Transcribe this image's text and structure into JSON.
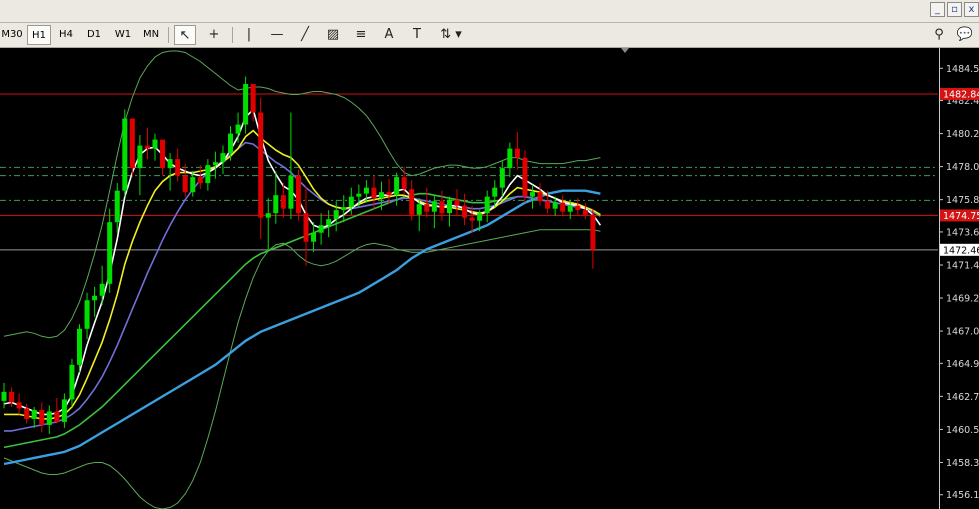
{
  "timeframes": [
    "M30",
    "H1",
    "H4",
    "D1",
    "W1",
    "MN"
  ],
  "selected_timeframe": "H1",
  "tools": [
    {
      "name": "cursor-tool-icon",
      "glyph": "↖"
    },
    {
      "name": "crosshair-tool-icon",
      "glyph": "+"
    },
    {
      "name": "vertical-line-tool-icon",
      "glyph": "|"
    },
    {
      "name": "horizontal-line-tool-icon",
      "glyph": "—"
    },
    {
      "name": "trendline-tool-icon",
      "glyph": "╱"
    },
    {
      "name": "equidistant-channel-tool-icon",
      "glyph": "▨"
    },
    {
      "name": "fibonacci-tool-icon",
      "glyph": "≡"
    },
    {
      "name": "text-tool-icon",
      "glyph": "A"
    },
    {
      "name": "text-label-tool-icon",
      "glyph": "T"
    },
    {
      "name": "arrows-tool-icon",
      "glyph": "⇅"
    }
  ],
  "window_buttons": [
    "minimize-icon",
    "restore-icon",
    "close-icon"
  ],
  "chart_data": {
    "type": "candlestick",
    "ylim": [
      1455.6,
      1485.5
    ],
    "price_ticks": [
      "1484.55",
      "1482.40",
      "1480.20",
      "1478.00",
      "1475.80",
      "1473.65",
      "1471.45",
      "1469.25",
      "1467.05",
      "1464.90",
      "1462.70",
      "1460.50",
      "1458.30",
      "1456.15"
    ],
    "tick_values": [
      1484.55,
      1482.4,
      1480.2,
      1478.0,
      1475.8,
      1473.65,
      1471.45,
      1469.25,
      1467.05,
      1464.9,
      1462.7,
      1460.5,
      1458.3,
      1456.15
    ],
    "current_price_label": "1472.46",
    "current_price": 1472.46,
    "red_line_labels": [
      {
        "text": "1482.84",
        "value": 1482.84
      },
      {
        "text": "1474.75",
        "value": 1474.75
      }
    ],
    "dashed_levels": [
      1477.95,
      1477.4,
      1475.75
    ],
    "candles": [
      [
        1462.4,
        1463.6,
        1461.9,
        1463.0
      ],
      [
        1463.0,
        1463.3,
        1462.0,
        1462.3
      ],
      [
        1462.3,
        1462.9,
        1461.5,
        1461.9
      ],
      [
        1461.9,
        1462.2,
        1460.9,
        1461.2
      ],
      [
        1461.2,
        1462.0,
        1460.6,
        1461.8
      ],
      [
        1461.8,
        1462.3,
        1460.3,
        1460.8
      ],
      [
        1460.8,
        1462.1,
        1460.2,
        1461.7
      ],
      [
        1461.7,
        1462.6,
        1460.9,
        1461.0
      ],
      [
        1461.0,
        1462.9,
        1460.6,
        1462.5
      ],
      [
        1462.5,
        1465.2,
        1462.0,
        1464.8
      ],
      [
        1464.8,
        1467.5,
        1464.3,
        1467.2
      ],
      [
        1467.2,
        1469.6,
        1466.5,
        1469.1
      ],
      [
        1469.1,
        1470.0,
        1468.0,
        1469.4
      ],
      [
        1469.4,
        1471.4,
        1468.8,
        1470.2
      ],
      [
        1470.2,
        1475.2,
        1469.6,
        1474.3
      ],
      [
        1474.3,
        1476.9,
        1473.6,
        1476.4
      ],
      [
        1476.4,
        1481.8,
        1476.0,
        1481.2
      ],
      [
        1481.2,
        1479.8,
        1477.3,
        1477.9
      ],
      [
        1477.9,
        1480.1,
        1476.1,
        1479.4
      ],
      [
        1479.4,
        1480.6,
        1478.5,
        1479.2
      ],
      [
        1479.2,
        1480.2,
        1478.4,
        1479.8
      ],
      [
        1479.8,
        1479.3,
        1477.4,
        1477.9
      ],
      [
        1477.9,
        1478.9,
        1476.4,
        1478.5
      ],
      [
        1478.5,
        1479.2,
        1477.0,
        1477.4
      ],
      [
        1477.4,
        1478.2,
        1476.0,
        1476.3
      ],
      [
        1476.3,
        1477.7,
        1476.0,
        1477.3
      ],
      [
        1477.3,
        1478.1,
        1476.5,
        1476.9
      ],
      [
        1476.9,
        1478.5,
        1476.4,
        1478.1
      ],
      [
        1478.1,
        1479.0,
        1477.2,
        1478.3
      ],
      [
        1478.3,
        1479.4,
        1477.5,
        1478.9
      ],
      [
        1478.9,
        1480.7,
        1478.4,
        1480.2
      ],
      [
        1480.2,
        1481.6,
        1479.6,
        1480.8
      ],
      [
        1480.8,
        1484.0,
        1480.2,
        1483.5
      ],
      [
        1483.5,
        1482.1,
        1481.0,
        1481.6
      ],
      [
        1481.6,
        1482.6,
        1473.2,
        1474.6
      ],
      [
        1474.6,
        1475.9,
        1472.4,
        1474.9
      ],
      [
        1474.9,
        1477.7,
        1474.2,
        1476.1
      ],
      [
        1476.1,
        1476.9,
        1474.6,
        1475.2
      ],
      [
        1475.2,
        1481.6,
        1474.5,
        1477.4
      ],
      [
        1477.4,
        1477.8,
        1474.4,
        1474.9
      ],
      [
        1474.9,
        1476.7,
        1471.4,
        1473.0
      ],
      [
        1473.0,
        1474.3,
        1472.3,
        1473.6
      ],
      [
        1473.6,
        1474.9,
        1472.8,
        1474.1
      ],
      [
        1474.1,
        1475.1,
        1473.3,
        1474.5
      ],
      [
        1474.5,
        1475.7,
        1473.7,
        1475.1
      ],
      [
        1475.1,
        1476.1,
        1474.3,
        1475.3
      ],
      [
        1475.3,
        1476.6,
        1474.8,
        1476.0
      ],
      [
        1476.0,
        1476.8,
        1475.3,
        1476.2
      ],
      [
        1476.2,
        1477.1,
        1475.6,
        1476.6
      ],
      [
        1476.6,
        1477.4,
        1475.2,
        1475.9
      ],
      [
        1475.9,
        1477.0,
        1475.1,
        1476.3
      ],
      [
        1476.3,
        1477.2,
        1475.5,
        1476.1
      ],
      [
        1476.1,
        1477.6,
        1475.4,
        1477.3
      ],
      [
        1477.3,
        1478.0,
        1476.1,
        1476.5
      ],
      [
        1476.5,
        1477.1,
        1474.4,
        1474.8
      ],
      [
        1474.8,
        1475.9,
        1473.7,
        1475.5
      ],
      [
        1475.5,
        1476.6,
        1474.6,
        1475.0
      ],
      [
        1475.0,
        1476.1,
        1473.9,
        1475.7
      ],
      [
        1475.7,
        1476.4,
        1474.4,
        1474.9
      ],
      [
        1474.9,
        1476.0,
        1474.0,
        1475.8
      ],
      [
        1475.8,
        1476.5,
        1474.8,
        1475.4
      ],
      [
        1475.4,
        1476.2,
        1474.1,
        1474.6
      ],
      [
        1474.6,
        1475.4,
        1473.6,
        1474.4
      ],
      [
        1474.4,
        1475.1,
        1473.7,
        1474.9
      ],
      [
        1474.9,
        1476.4,
        1474.3,
        1476.0
      ],
      [
        1476.0,
        1477.1,
        1475.3,
        1476.6
      ],
      [
        1476.6,
        1478.4,
        1476.0,
        1477.9
      ],
      [
        1477.9,
        1479.6,
        1477.3,
        1479.2
      ],
      [
        1479.2,
        1480.3,
        1477.8,
        1478.6
      ],
      [
        1478.6,
        1479.1,
        1475.6,
        1476.0
      ],
      [
        1476.0,
        1476.8,
        1475.2,
        1476.3
      ],
      [
        1476.3,
        1476.9,
        1475.4,
        1475.7
      ],
      [
        1475.7,
        1476.4,
        1474.9,
        1475.2
      ],
      [
        1475.2,
        1476.0,
        1474.7,
        1475.6
      ],
      [
        1475.6,
        1476.1,
        1474.8,
        1475.0
      ],
      [
        1475.0,
        1475.8,
        1474.5,
        1475.4
      ],
      [
        1475.4,
        1475.9,
        1474.8,
        1475.1
      ],
      [
        1475.1,
        1475.6,
        1474.5,
        1474.8
      ],
      [
        1474.8,
        1475.2,
        1471.2,
        1472.46
      ]
    ],
    "indicators": [
      {
        "name": "bollinger-upper",
        "color": "#5aa85a",
        "values": [
          1466.7,
          1466.8,
          1466.9,
          1467.0,
          1466.9,
          1466.7,
          1466.6,
          1466.7,
          1467.1,
          1467.9,
          1469.0,
          1470.5,
          1472.2,
          1474.1,
          1476.4,
          1478.8,
          1481.0,
          1482.6,
          1483.9,
          1484.7,
          1485.3,
          1485.6,
          1485.7,
          1485.7,
          1485.6,
          1485.3,
          1485.0,
          1484.6,
          1484.2,
          1483.8,
          1483.4,
          1483.1,
          1483.2,
          1483.3,
          1483.3,
          1483.2,
          1483.0,
          1482.9,
          1482.8,
          1482.8,
          1482.9,
          1483.0,
          1483.0,
          1482.9,
          1482.8,
          1482.6,
          1482.3,
          1481.9,
          1481.4,
          1480.7,
          1479.9,
          1479.0,
          1478.2,
          1477.6,
          1477.4,
          1477.5,
          1477.7,
          1477.9,
          1478.0,
          1478.1,
          1478.1,
          1478.0,
          1477.9,
          1477.9,
          1478.0,
          1478.2,
          1478.4,
          1478.6,
          1478.6,
          1478.4,
          1478.3,
          1478.2,
          1478.2,
          1478.2,
          1478.2,
          1478.3,
          1478.4,
          1478.4,
          1478.5,
          1478.6
        ]
      },
      {
        "name": "bollinger-lower",
        "color": "#5aa85a",
        "values": [
          1458.6,
          1458.4,
          1458.2,
          1458.0,
          1457.8,
          1457.6,
          1457.5,
          1457.5,
          1457.6,
          1457.8,
          1458.0,
          1458.2,
          1458.3,
          1458.3,
          1458.1,
          1457.7,
          1457.2,
          1456.6,
          1456.0,
          1455.6,
          1455.3,
          1455.2,
          1455.3,
          1455.6,
          1456.2,
          1457.1,
          1458.3,
          1459.9,
          1461.7,
          1463.7,
          1465.7,
          1467.6,
          1469.2,
          1470.6,
          1471.7,
          1472.4,
          1472.8,
          1472.9,
          1472.6,
          1472.1,
          1471.7,
          1471.5,
          1471.4,
          1471.5,
          1471.7,
          1472.0,
          1472.3,
          1472.6,
          1472.8,
          1472.9,
          1472.8,
          1472.7,
          1472.5,
          1472.4,
          1472.3,
          1472.3,
          1472.3,
          1472.4,
          1472.5,
          1472.6,
          1472.7,
          1472.8,
          1472.9,
          1473.0,
          1473.1,
          1473.2,
          1473.3,
          1473.4,
          1473.5,
          1473.6,
          1473.7,
          1473.8,
          1473.8,
          1473.8,
          1473.8,
          1473.8,
          1473.8,
          1473.8,
          1473.8,
          1473.7
        ]
      },
      {
        "name": "moving-average-slow-blue",
        "color": "#3aa0e0",
        "values": [
          1458.2,
          1458.3,
          1458.4,
          1458.5,
          1458.6,
          1458.7,
          1458.8,
          1458.9,
          1459.0,
          1459.2,
          1459.4,
          1459.7,
          1460.0,
          1460.3,
          1460.6,
          1460.9,
          1461.2,
          1461.5,
          1461.8,
          1462.1,
          1462.4,
          1462.7,
          1463.0,
          1463.3,
          1463.6,
          1463.9,
          1464.2,
          1464.5,
          1464.8,
          1465.2,
          1465.6,
          1466.0,
          1466.4,
          1466.7,
          1467.0,
          1467.2,
          1467.4,
          1467.6,
          1467.8,
          1468.0,
          1468.2,
          1468.4,
          1468.6,
          1468.8,
          1469.0,
          1469.2,
          1469.4,
          1469.6,
          1469.9,
          1470.2,
          1470.5,
          1470.8,
          1471.1,
          1471.5,
          1471.9,
          1472.2,
          1472.5,
          1472.7,
          1472.9,
          1473.1,
          1473.3,
          1473.5,
          1473.7,
          1473.9,
          1474.1,
          1474.4,
          1474.7,
          1475.0,
          1475.3,
          1475.6,
          1475.8,
          1476.0,
          1476.2,
          1476.3,
          1476.4,
          1476.4,
          1476.4,
          1476.4,
          1476.3,
          1476.2
        ]
      },
      {
        "name": "moving-average-green",
        "color": "#3cc23c",
        "values": [
          1459.3,
          1459.4,
          1459.5,
          1459.6,
          1459.7,
          1459.8,
          1459.9,
          1460.0,
          1460.2,
          1460.5,
          1460.8,
          1461.2,
          1461.6,
          1462.0,
          1462.5,
          1463.0,
          1463.5,
          1464.0,
          1464.5,
          1465.0,
          1465.5,
          1466.0,
          1466.5,
          1467.0,
          1467.5,
          1468.0,
          1468.5,
          1469.0,
          1469.5,
          1470.0,
          1470.5,
          1471.0,
          1471.5,
          1471.9,
          1472.2,
          1472.4,
          1472.6,
          1472.8,
          1473.0,
          1473.2,
          1473.4,
          1473.6,
          1473.8,
          1474.0,
          1474.2,
          1474.4,
          1474.6,
          1474.8,
          1475.0,
          1475.2,
          1475.4,
          1475.6,
          1475.8,
          1476.0,
          1476.1,
          1476.2,
          1476.2,
          1476.1,
          1476.0,
          1475.9,
          1475.8,
          1475.7,
          1475.6,
          1475.6,
          1475.6,
          1475.7,
          1475.8,
          1475.9,
          1476.0,
          1476.0,
          1475.9,
          1475.8,
          1475.7,
          1475.6,
          1475.5,
          1475.4,
          1475.3,
          1475.2,
          1475.0,
          1474.7
        ]
      },
      {
        "name": "moving-average-purple",
        "color": "#7070d8",
        "values": [
          1460.4,
          1460.4,
          1460.5,
          1460.6,
          1460.7,
          1460.8,
          1460.9,
          1461.0,
          1461.2,
          1461.5,
          1461.9,
          1462.5,
          1463.2,
          1464.0,
          1465.0,
          1466.1,
          1467.3,
          1468.5,
          1469.7,
          1470.9,
          1472.0,
          1473.1,
          1474.1,
          1475.0,
          1475.8,
          1476.5,
          1477.1,
          1477.6,
          1478.0,
          1478.4,
          1478.8,
          1479.2,
          1479.6,
          1479.5,
          1479.1,
          1478.7,
          1478.3,
          1478.0,
          1477.6,
          1477.1,
          1476.6,
          1476.2,
          1475.8,
          1475.5,
          1475.3,
          1475.2,
          1475.2,
          1475.3,
          1475.4,
          1475.5,
          1475.6,
          1475.7,
          1475.8,
          1475.9,
          1475.9,
          1475.8,
          1475.7,
          1475.6,
          1475.5,
          1475.4,
          1475.3,
          1475.3,
          1475.2,
          1475.2,
          1475.3,
          1475.4,
          1475.6,
          1475.8,
          1476.0,
          1476.0,
          1475.9,
          1475.8,
          1475.7,
          1475.6,
          1475.5,
          1475.4,
          1475.3,
          1475.2,
          1475.0,
          1474.8
        ]
      },
      {
        "name": "moving-average-yellow",
        "color": "#f0f020",
        "values": [
          1461.5,
          1461.5,
          1461.5,
          1461.4,
          1461.3,
          1461.2,
          1461.2,
          1461.3,
          1461.5,
          1462.0,
          1462.8,
          1463.9,
          1465.1,
          1466.3,
          1467.8,
          1469.5,
          1471.5,
          1473.0,
          1474.3,
          1475.4,
          1476.4,
          1477.0,
          1477.4,
          1477.6,
          1477.6,
          1477.6,
          1477.7,
          1477.8,
          1478.0,
          1478.3,
          1478.7,
          1479.2,
          1480.0,
          1480.4,
          1479.9,
          1479.5,
          1479.1,
          1478.8,
          1478.6,
          1478.1,
          1477.3,
          1476.5,
          1475.9,
          1475.5,
          1475.3,
          1475.2,
          1475.3,
          1475.5,
          1475.7,
          1475.8,
          1475.9,
          1476.0,
          1476.1,
          1476.1,
          1475.9,
          1475.7,
          1475.5,
          1475.4,
          1475.3,
          1475.3,
          1475.2,
          1475.1,
          1475.0,
          1474.9,
          1475.0,
          1475.3,
          1475.7,
          1476.2,
          1476.6,
          1476.5,
          1476.4,
          1476.3,
          1476.1,
          1475.9,
          1475.7,
          1475.6,
          1475.5,
          1475.3,
          1475.1,
          1474.8
        ]
      },
      {
        "name": "moving-average-white",
        "color": "#ffffff",
        "values": [
          1462.2,
          1462.3,
          1462.1,
          1461.9,
          1461.7,
          1461.5,
          1461.5,
          1461.6,
          1461.9,
          1462.8,
          1464.3,
          1466.1,
          1467.6,
          1469.0,
          1470.9,
          1473.2,
          1476.0,
          1477.6,
          1478.8,
          1479.2,
          1479.3,
          1478.8,
          1478.2,
          1477.9,
          1477.7,
          1477.5,
          1477.4,
          1477.6,
          1477.9,
          1478.3,
          1479.1,
          1480.0,
          1481.3,
          1481.8,
          1480.0,
          1478.4,
          1477.5,
          1476.7,
          1476.4,
          1475.8,
          1474.8,
          1474.1,
          1473.9,
          1474.1,
          1474.5,
          1474.8,
          1475.2,
          1475.6,
          1475.9,
          1476.0,
          1476.1,
          1476.1,
          1476.4,
          1476.5,
          1476.0,
          1475.6,
          1475.4,
          1475.4,
          1475.3,
          1475.4,
          1475.4,
          1475.2,
          1474.9,
          1474.8,
          1475.0,
          1475.4,
          1476.0,
          1476.8,
          1477.4,
          1477.1,
          1476.8,
          1476.5,
          1476.1,
          1475.9,
          1475.6,
          1475.5,
          1475.4,
          1475.2,
          1474.8,
          1474.1
        ]
      }
    ]
  }
}
